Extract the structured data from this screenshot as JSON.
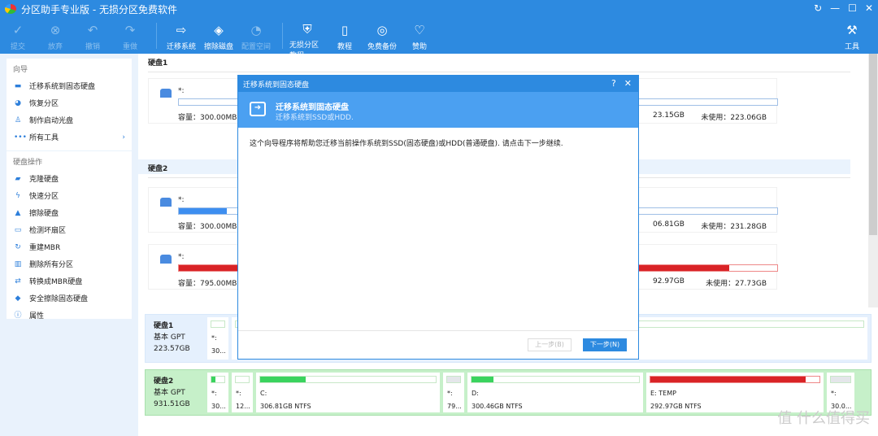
{
  "window": {
    "title": "分区助手专业版 - 无损分区免费软件",
    "controls": [
      "↻",
      "—",
      "☐",
      "✕"
    ]
  },
  "toolbar": {
    "items": [
      {
        "label": "提交",
        "icon": "✓",
        "enabled": false
      },
      {
        "label": "放弃",
        "icon": "⊗",
        "enabled": false
      },
      {
        "label": "撤销",
        "icon": "↶",
        "enabled": false
      },
      {
        "label": "重做",
        "icon": "↷",
        "enabled": false
      },
      {
        "label": "迁移系统",
        "icon": "⇨",
        "enabled": true
      },
      {
        "label": "擦除磁盘",
        "icon": "◈",
        "enabled": true
      },
      {
        "label": "配置空间",
        "icon": "◔",
        "enabled": false
      },
      {
        "label": "无损分区教程",
        "icon": "⛨",
        "enabled": true
      },
      {
        "label": "教程",
        "icon": "▯",
        "enabled": true
      },
      {
        "label": "免费备份",
        "icon": "◎",
        "enabled": true
      },
      {
        "label": "赞助",
        "icon": "♡",
        "enabled": true
      }
    ],
    "tools_label": "工具",
    "tools_icon": "⚒"
  },
  "sidebar": {
    "wizard": {
      "title": "向导",
      "items": [
        {
          "label": "迁移系统到固态硬盘",
          "icon": "▬"
        },
        {
          "label": "恢复分区",
          "icon": "◕"
        },
        {
          "label": "制作启动光盘",
          "icon": "♙"
        },
        {
          "label": "所有工具",
          "icon": "•••"
        }
      ]
    },
    "disk_ops": {
      "title": "硬盘操作",
      "items": [
        {
          "label": "克隆硬盘",
          "icon": "▰"
        },
        {
          "label": "快速分区",
          "icon": "ϟ"
        },
        {
          "label": "擦除硬盘",
          "icon": "▲"
        },
        {
          "label": "检测坏扇区",
          "icon": "▭"
        },
        {
          "label": "重建MBR",
          "icon": "↻"
        },
        {
          "label": "删除所有分区",
          "icon": "▥"
        },
        {
          "label": "转换成MBR硬盘",
          "icon": "⇄"
        },
        {
          "label": "安全擦除固态硬盘",
          "icon": "◆"
        },
        {
          "label": "属性",
          "icon": "ⓘ"
        }
      ]
    }
  },
  "main": {
    "disk1": {
      "title": "硬盘1",
      "partitions": [
        {
          "label": "*:",
          "capacity": "容量：300.00MB",
          "used": "23.15GB",
          "free": "未使用：223.06GB",
          "fill": 0
        }
      ]
    },
    "disk2": {
      "title": "硬盘2",
      "partitions": [
        {
          "label": "*:",
          "capacity": "容量：300.00MB",
          "used": "06.81GB",
          "free": "未使用：231.28GB",
          "fill": 8,
          "color": "#3d8ef0"
        },
        {
          "label": "*:",
          "capacity": "容量：795.00MB",
          "used": "92.97GB",
          "free": "未使用：27.73GB",
          "fill": 92,
          "color": "#d92326"
        }
      ]
    }
  },
  "dialog": {
    "title": "迁移系统到固态硬盘",
    "help": "?",
    "close": "✕",
    "heading": "迁移系统到固态硬盘",
    "subheading": "迁移系统到SSD或HDD.",
    "body": "这个向导程序将帮助您迁移当前操作系统到SSD(固态硬盘)或HDD(普通硬盘). 请点击下一步继续.",
    "prev": "上一步(B)",
    "next": "下一步(N)"
  },
  "diskmap": {
    "disk1": {
      "name": "硬盘1",
      "type": "基本 GPT",
      "size": "223.57GB",
      "partitions": [
        {
          "label": "*:",
          "size": "30..."
        }
      ]
    },
    "disk2": {
      "name": "硬盘2",
      "type": "基本 GPT",
      "size": "931.51GB",
      "partitions": [
        {
          "label": "*:",
          "size": "30...",
          "fill": 30,
          "color": "#3ad35e"
        },
        {
          "label": "*:",
          "size": "12...",
          "fill": 0
        },
        {
          "label": "C:",
          "size": "306.81GB NTFS",
          "fill": 26,
          "color": "#3ad35e"
        },
        {
          "label": "*:",
          "size": "79...",
          "fill": 100,
          "color": "#e4e6ea"
        },
        {
          "label": "D:",
          "size": "300.46GB NTFS",
          "fill": 13,
          "color": "#3ad35e"
        },
        {
          "label": "E: TEMP",
          "size": "292.97GB NTFS",
          "fill": 92,
          "color": "#d92326"
        },
        {
          "label": "*:",
          "size": "30.0...",
          "fill": 100,
          "color": "#e4e6ea"
        }
      ]
    }
  },
  "watermark": "值 什么值得买"
}
